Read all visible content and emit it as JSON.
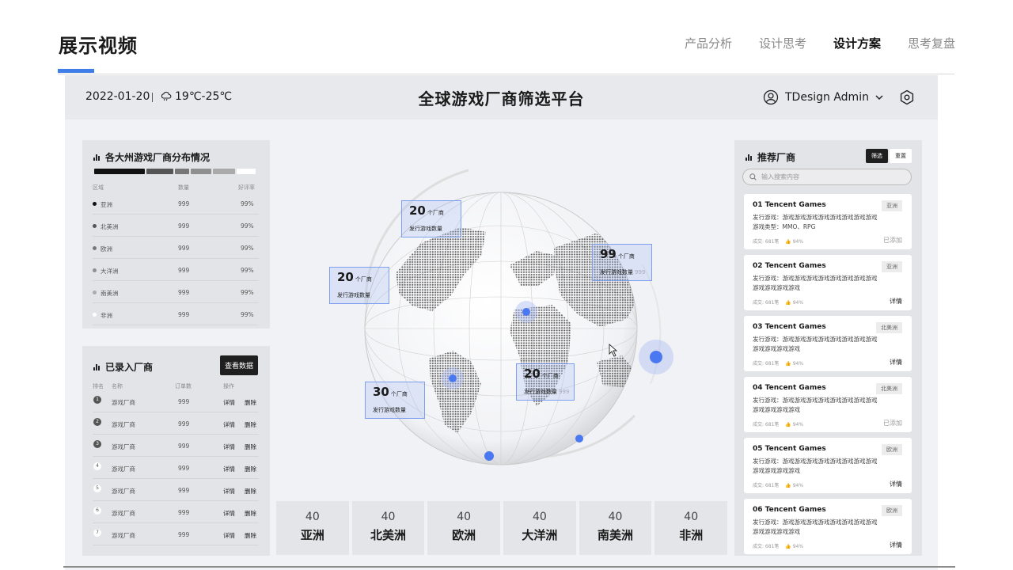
{
  "header": {
    "title": "展示视频",
    "nav": [
      "产品分析",
      "设计思考",
      "设计方案",
      "思考复盘"
    ],
    "active_index": 2
  },
  "dashboard": {
    "date": "2022-01-20",
    "weather": "19℃-25℃",
    "title": "全球游戏厂商筛选平台",
    "user": "TDesign Admin"
  },
  "distribution": {
    "title": "各大州游戏厂商分布情况",
    "columns": [
      "区域",
      "数量",
      "好评率"
    ],
    "rows": [
      {
        "region": "亚洲",
        "count": "999",
        "rate": "99%",
        "color": "#111111"
      },
      {
        "region": "北美洲",
        "count": "999",
        "rate": "99%",
        "color": "#555555"
      },
      {
        "region": "欧洲",
        "count": "999",
        "rate": "99%",
        "color": "#777777"
      },
      {
        "region": "大洋洲",
        "count": "999",
        "rate": "99%",
        "color": "#8f8f8f"
      },
      {
        "region": "南美洲",
        "count": "999",
        "rate": "99%",
        "color": "#aaaaaa"
      },
      {
        "region": "非洲",
        "count": "999",
        "rate": "99%",
        "color": "#ffffff"
      }
    ]
  },
  "vendors": {
    "title": "已录入厂商",
    "button": "查看数据",
    "columns": [
      "排名",
      "名称",
      "订单数",
      "操作"
    ],
    "detail": "详情",
    "delete": "删除",
    "rows": [
      {
        "rank": "1",
        "name": "游戏厂商",
        "orders": "999"
      },
      {
        "rank": "2",
        "name": "游戏厂商",
        "orders": "999"
      },
      {
        "rank": "3",
        "name": "游戏厂商",
        "orders": "999"
      },
      {
        "rank": "4",
        "name": "游戏厂商",
        "orders": "999"
      },
      {
        "rank": "5",
        "name": "游戏厂商",
        "orders": "999"
      },
      {
        "rank": "6",
        "name": "游戏厂商",
        "orders": "999"
      },
      {
        "rank": "7",
        "name": "游戏厂商",
        "orders": "999"
      }
    ]
  },
  "globe": {
    "unit": "个厂商",
    "sublabel": "发行游戏数量",
    "labels": [
      {
        "value": "20",
        "faint": ""
      },
      {
        "value": "99",
        "faint": "999"
      },
      {
        "value": "20",
        "faint": ""
      },
      {
        "value": "30",
        "faint": ""
      },
      {
        "value": "20",
        "faint": "999"
      }
    ]
  },
  "continents": [
    {
      "value": "40",
      "name": "亚洲"
    },
    {
      "value": "40",
      "name": "北美洲"
    },
    {
      "value": "40",
      "name": "欧洲"
    },
    {
      "value": "40",
      "name": "大洋洲"
    },
    {
      "value": "40",
      "name": "南美洲"
    },
    {
      "value": "40",
      "name": "非洲"
    }
  ],
  "recommend": {
    "title": "推荐厂商",
    "tab_filter": "筛选",
    "tab_reset": "重置",
    "search_placeholder": "输入搜索内容",
    "cards": [
      {
        "name": "01 Tencent Games",
        "tag": "亚洲",
        "line1": "发行游戏：游戏游戏游戏游戏游戏游戏游戏游戏",
        "line2": "游戏类型：MMO、RPG",
        "meta": "成交: 681笔",
        "likes": "94%",
        "action": "已添加"
      },
      {
        "name": "02 Tencent Games",
        "tag": "亚洲",
        "line1": "发行游戏：游戏游戏游戏游戏游戏游戏游戏游戏",
        "line2": "游戏游戏游戏游戏",
        "meta": "成交: 681笔",
        "likes": "94%",
        "action": "详情"
      },
      {
        "name": "03 Tencent Games",
        "tag": "北美洲",
        "line1": "发行游戏：游戏游戏游戏游戏游戏游戏游戏游戏",
        "line2": "游戏游戏游戏游戏",
        "meta": "成交: 681笔",
        "likes": "94%",
        "action": "详情"
      },
      {
        "name": "04 Tencent Games",
        "tag": "北美洲",
        "line1": "发行游戏：游戏游戏游戏游戏游戏游戏游戏游戏",
        "line2": "游戏游戏游戏游戏",
        "meta": "成交: 681笔",
        "likes": "94%",
        "action": "已添加"
      },
      {
        "name": "05 Tencent Games",
        "tag": "欧洲",
        "line1": "发行游戏：游戏游戏游戏游戏游戏游戏游戏游戏",
        "line2": "游戏游戏游戏游戏",
        "meta": "成交: 681笔",
        "likes": "94%",
        "action": "详情"
      },
      {
        "name": "06 Tencent Games",
        "tag": "欧洲",
        "line1": "发行游戏：游戏游戏游戏游戏游戏游戏游戏游戏",
        "line2": "游戏游戏游戏游戏",
        "meta": "成交: 681笔",
        "likes": "94%",
        "action": "详情"
      }
    ]
  },
  "colors": {
    "accent": "#3f7ee8",
    "marker": "#4a78f0",
    "dark_button": "#1f1f1f"
  }
}
